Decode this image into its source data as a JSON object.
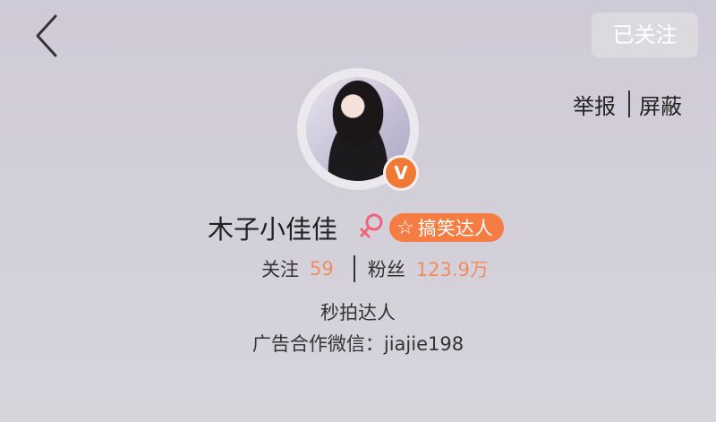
{
  "header": {
    "follow_button_label": "已关注"
  },
  "actions": {
    "report_label": "举报",
    "block_label": "屏蔽"
  },
  "profile": {
    "verified_badge": "V",
    "name": "木子小佳佳",
    "gender_icon": "female-icon",
    "tag": {
      "icon": "star-icon",
      "label": "搞笑达人"
    },
    "stats": {
      "following_label": "关注",
      "following_count": "59",
      "followers_label": "粉丝",
      "followers_count": "123.9万"
    },
    "bio_line1": "秒拍达人",
    "bio_line2": "广告合作微信：jiajie198"
  },
  "colors": {
    "accent": "#f57d43",
    "count_color": "#f28c60",
    "gender_color": "#f0647a",
    "background": "#d0ccd8"
  }
}
